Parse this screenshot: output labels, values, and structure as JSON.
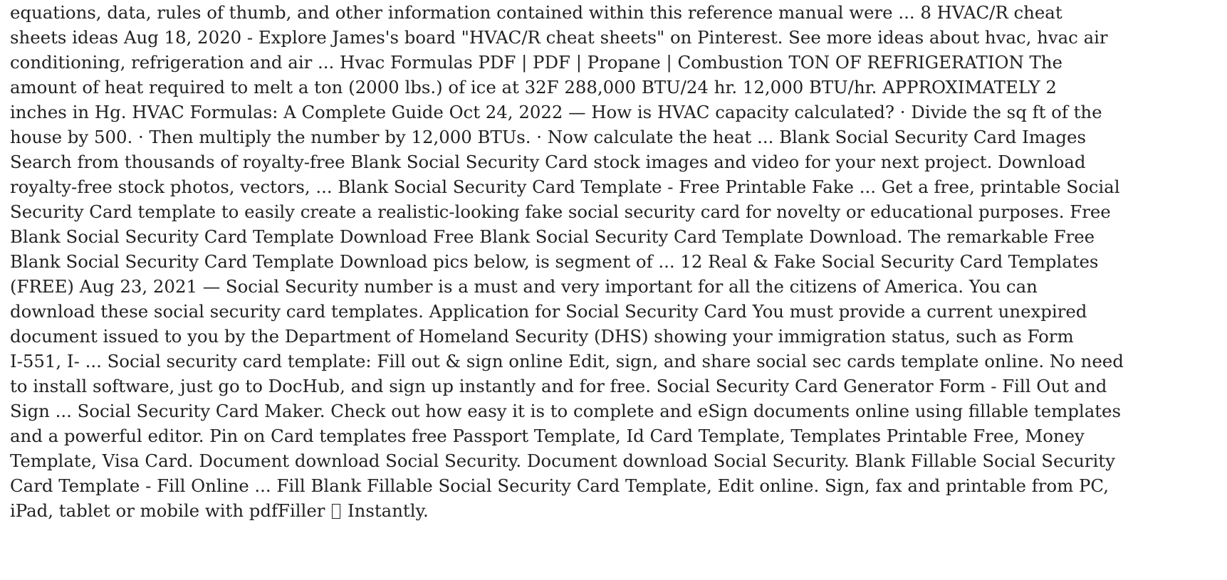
{
  "document": {
    "lines": [
      "equations, data, rules of thumb, and other information contained within this reference manual were ... 8 HVAC/R cheat",
      "sheets ideas Aug 18, 2020 - Explore James's board \"HVAC/R cheat sheets\" on Pinterest. See more ideas about hvac, hvac air",
      "conditioning, refrigeration and air ... Hvac Formulas PDF | PDF | Propane | Combustion TON OF REFRIGERATION The",
      "amount of heat required to melt a ton (2000 lbs.) of ice at 32F 288,000 BTU/24 hr. 12,000 BTU/hr. APPROXIMATELY 2",
      "inches in Hg. HVAC Formulas: A Complete Guide Oct 24, 2022 — How is HVAC capacity calculated? · Divide the sq ft of the",
      "house by 500. · Then multiply the number by 12,000 BTUs. · Now calculate the heat ... Blank Social Security Card Images",
      "Search from thousands of royalty-free Blank Social Security Card stock images and video for your next project. Download",
      "royalty-free stock photos, vectors, ... Blank Social Security Card Template - Free Printable Fake ... Get a free, printable Social",
      "Security Card template to easily create a realistic-looking fake social security card for novelty or educational purposes. Free",
      "Blank Social Security Card Template Download Free Blank Social Security Card Template Download. The remarkable Free",
      "Blank Social Security Card Template Download pics below, is segment of ... 12 Real & Fake Social Security Card Templates",
      "(FREE) Aug 23, 2021 — Social Security number is a must and very important for all the citizens of America. You can",
      "download these social security card templates. Application for Social Security Card You must provide a current unexpired",
      "document issued to you by the Department of Homeland Security (DHS) showing your immigration status, such as Form",
      "I-551, I- ... Social security card template: Fill out & sign online Edit, sign, and share social sec cards template online. No need",
      "to install software, just go to DocHub, and sign up instantly and for free. Social Security Card Generator Form - Fill Out and",
      "Sign ... Social Security Card Maker. Check out how easy it is to complete and eSign documents online using fillable templates",
      "and a powerful editor. Pin on Card templates free Passport Template, Id Card Template, Templates Printable Free, Money",
      "Template, Visa Card. Document download Social Security. Document download Social Security. Blank Fillable Social Security",
      "Card Template - Fill Online ... Fill Blank Fillable Social Security Card Template, Edit online. Sign, fax and printable from PC,"
    ],
    "last_line_before": "iPad, tablet or mobile with pdfFiller",
    "last_line_after": "Instantly."
  }
}
